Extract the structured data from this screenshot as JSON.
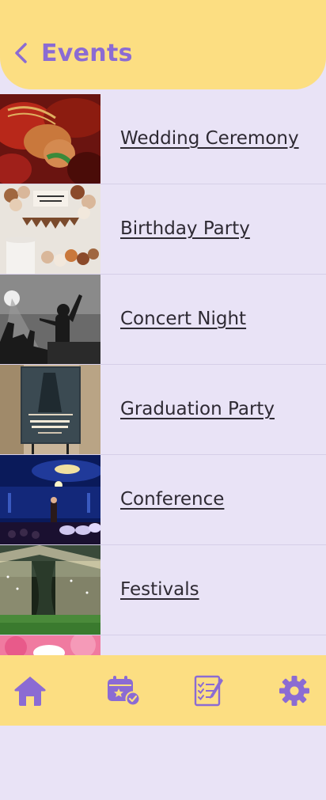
{
  "header": {
    "title": "Events",
    "back_icon": "chevron-left-icon"
  },
  "events": [
    {
      "label": "Wedding Ceremony",
      "image": "wedding-hands-photo"
    },
    {
      "label": "Birthday Party",
      "image": "birthday-balloons-photo"
    },
    {
      "label": "Concert Night",
      "image": "concert-crowd-photo"
    },
    {
      "label": "Graduation Party",
      "image": "graduation-sign-photo"
    },
    {
      "label": "Conference",
      "image": "conference-stage-photo"
    },
    {
      "label": "Festivals",
      "image": "festival-lights-photo"
    }
  ],
  "bottom_nav": [
    {
      "icon": "home-icon"
    },
    {
      "icon": "calendar-check-icon"
    },
    {
      "icon": "checklist-icon"
    },
    {
      "icon": "gear-icon"
    }
  ],
  "colors": {
    "accent": "#8B6BD3",
    "header_bg": "#FCDE82",
    "page_bg": "#E9E3F6"
  }
}
